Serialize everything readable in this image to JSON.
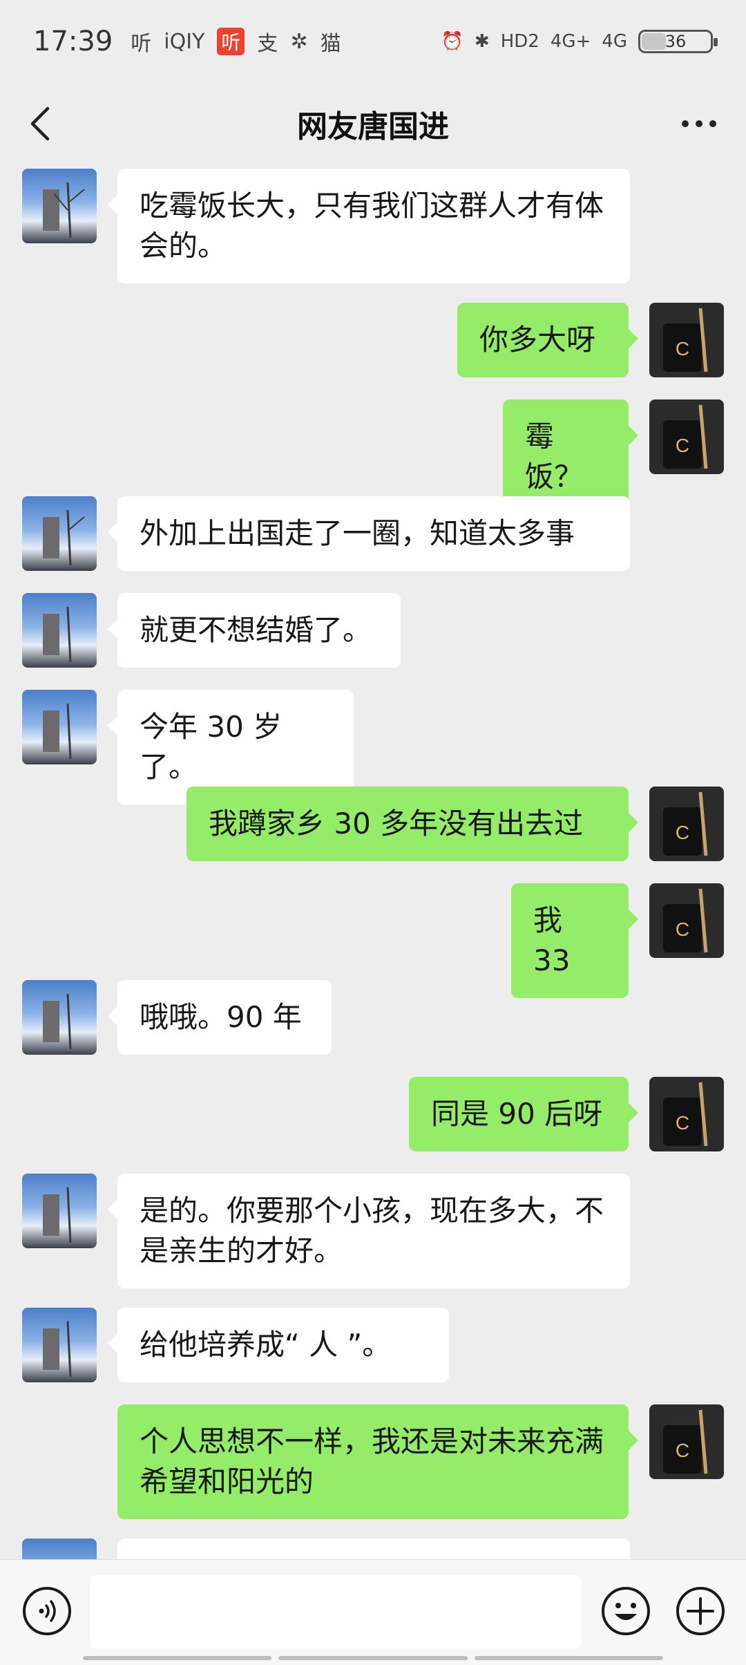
{
  "status_bar": {
    "time": "17:39",
    "app_icons": [
      "听",
      "iQIY",
      "听",
      "支",
      "✲",
      "猫"
    ],
    "network": [
      "HD2",
      "4G+",
      "4G"
    ],
    "battery": "36"
  },
  "header": {
    "title": "网友唐国进"
  },
  "messages": [
    {
      "side": "left",
      "text": "吃霉饭长大，只有我们这群人才有体会的。"
    },
    {
      "side": "right",
      "text": "你多大呀"
    },
    {
      "side": "right",
      "text": "霉饭？"
    },
    {
      "side": "left",
      "text": "外加上出国走了一圈，知道太多事"
    },
    {
      "side": "left",
      "text": "就更不想结婚了。"
    },
    {
      "side": "left",
      "text": "今年 30 岁了。"
    },
    {
      "side": "right",
      "text": "我蹲家乡 30 多年没有出去过"
    },
    {
      "side": "right",
      "text": "我 33"
    },
    {
      "side": "left",
      "text": "哦哦。90 年"
    },
    {
      "side": "right",
      "text": "同是 90 后呀"
    },
    {
      "side": "left",
      "text": "是的。你要那个小孩，现在多大，不是亲生的才好。"
    },
    {
      "side": "left",
      "text": "给他培养成“ 人 ”。"
    },
    {
      "side": "right",
      "text": "个人思想不一样，我还是对未来充满希望和阳光的"
    }
  ],
  "input": {
    "value": "",
    "placeholder": ""
  },
  "colors": {
    "background": "#ededed",
    "bubble_self": "#95ec69",
    "bubble_other": "#ffffff"
  },
  "icons": {
    "back": "back-arrow-icon",
    "more": "more-dots-icon",
    "voice": "voice-icon",
    "emoji": "emoji-icon",
    "plus": "plus-icon"
  }
}
